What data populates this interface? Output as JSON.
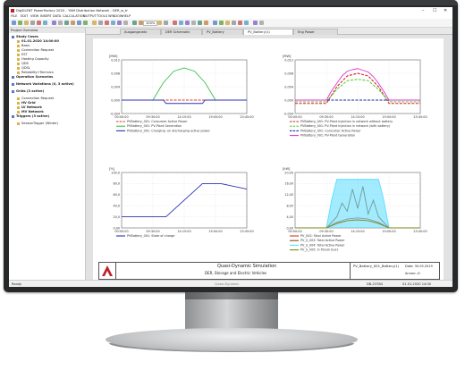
{
  "window": {
    "title": "DIgSILENT PowerFactory 2020 - 'YAM Distribution Network - DER_w_b'",
    "minimize_glyph": "–",
    "maximize_glyph": "☐",
    "close_glyph": "✕"
  },
  "menu": [
    "FILE",
    "EDIT",
    "VIEW",
    "INSERT",
    "DATA",
    "CALCULATION",
    "OUTPUT",
    "TOOLS",
    "WINDOW",
    "HELP"
  ],
  "toolbar": {
    "zoom": "100%"
  },
  "tabs": [
    "Ausgangsnetz",
    "DER Schematic",
    "PV_Battery",
    "PV_Battery(1)",
    "Eng Power"
  ],
  "sidebar": {
    "header": "Project Overview",
    "sections": [
      {
        "label": "Study Cases",
        "bold": true,
        "indent": 0
      },
      {
        "label": "01.01.2020 14:00:00",
        "bold": true,
        "indent": 1
      },
      {
        "label": "Basic",
        "bold": false,
        "indent": 1
      },
      {
        "label": "Connection Request",
        "bold": false,
        "indent": 1
      },
      {
        "label": "EST",
        "bold": false,
        "indent": 1
      },
      {
        "label": "Hosting Capacity",
        "bold": false,
        "indent": 1
      },
      {
        "label": "QDS",
        "bold": false,
        "indent": 1
      },
      {
        "label": "QDSL",
        "bold": false,
        "indent": 1
      },
      {
        "label": "Reliability+Technics",
        "bold": false,
        "indent": 1
      },
      {
        "label": "Operation Scenarios",
        "bold": true,
        "indent": 0
      },
      {
        "label": "Network Variations (0, 3 active)",
        "bold": true,
        "indent": 0
      },
      {
        "label": "Grids (3 active)",
        "bold": true,
        "indent": 0
      },
      {
        "label": "Connection Request",
        "bold": false,
        "indent": 1
      },
      {
        "label": "HV Grid",
        "bold": true,
        "indent": 1
      },
      {
        "label": "LV Network",
        "bold": true,
        "indent": 1
      },
      {
        "label": "MV Network",
        "bold": true,
        "indent": 1
      },
      {
        "label": "Triggers (3 active)",
        "bold": true,
        "indent": 0
      },
      {
        "label": "SeasonTrigger (Winter)",
        "bold": false,
        "indent": 1
      }
    ]
  },
  "footer": {
    "title": "Quasi-Dynamic Simulation",
    "subtitle": "DER, Storage and Electric Vehicles",
    "plot_name": "PV_Battery_001_Battery(1)",
    "date": "Date: 30.05.2019",
    "annex": "Annex: /4"
  },
  "status": {
    "left": "Ready",
    "center": "Quasi-Dynamic",
    "right1": "DB-23784",
    "right2": "01.01.2020 14:00"
  },
  "colors": {
    "green": "#3ec04a",
    "blue": "#2a34b0",
    "red": "#e0342c",
    "dash_red": "#d82020",
    "dash_green": "#5ecf3c",
    "dash_blue": "#1b2a9a",
    "magenta": "#e030d0",
    "brown": "#8a4a14",
    "cyan": "#58dcff",
    "olive": "#7a8a10"
  },
  "chart_data": [
    {
      "type": "line",
      "ylabel": "[MW]",
      "ylim": [
        -0.004,
        0.012
      ],
      "yticks": [
        "0,012",
        "0,008",
        "0,004",
        "0,000",
        "-0,004"
      ],
      "xticks": [
        "00:00:00",
        "09:30:00",
        "14:15:00",
        "19:00:00",
        "23:45:00"
      ],
      "series": [
        {
          "name": "PVBattery_001: Consumer Active Power",
          "style": "dashed",
          "color_key": "red",
          "x": [
            0,
            4,
            8,
            12,
            16,
            20,
            24
          ],
          "y": [
            0.0,
            0.0,
            0.0,
            0.0,
            0.0,
            0.0,
            0.0
          ]
        },
        {
          "name": "PVBattery_001: PV-Plant Generation",
          "style": "solid",
          "color_key": "green",
          "x": [
            0,
            6,
            8,
            10,
            12,
            14,
            16,
            18,
            24
          ],
          "y": [
            0.0,
            0.0,
            0.0052,
            0.0086,
            0.0096,
            0.0086,
            0.0052,
            0.0,
            0.0
          ]
        },
        {
          "name": "PVBattery_001: Charging- on discharging active power",
          "style": "solid",
          "color_key": "blue",
          "x": [
            0,
            8,
            8.5,
            15.5,
            16,
            24
          ],
          "y": [
            0.0,
            0.0,
            -0.001,
            -0.001,
            0.0,
            0.0
          ]
        }
      ]
    },
    {
      "type": "line",
      "ylabel": "[MW]",
      "ylim": [
        -0.004,
        0.012
      ],
      "yticks": [
        "0,012",
        "0,008",
        "0,004",
        "0,000",
        "-0,004"
      ],
      "xticks": [
        "00:00:00",
        "09:30:00",
        "14:15:00",
        "19:00:00",
        "23:45:00"
      ],
      "series": [
        {
          "name": "PVBattery_001: PV-Plant Injection in network without battery",
          "style": "dashed",
          "color_key": "dash_red",
          "x": [
            0,
            6,
            8,
            10,
            12,
            14,
            16,
            18,
            24
          ],
          "y": [
            -0.001,
            -0.001,
            0.004,
            0.0072,
            0.008,
            0.0072,
            0.004,
            -0.001,
            -0.001
          ]
        },
        {
          "name": "PVBattery_001: PV-Plant Injection in network (with battery)",
          "style": "dashed",
          "color_key": "dash_green",
          "x": [
            0,
            6,
            8,
            10,
            12,
            14,
            16,
            18,
            24
          ],
          "y": [
            -0.0005,
            -0.0005,
            0.0032,
            0.0058,
            0.0062,
            0.0058,
            0.0032,
            -0.0005,
            -0.0005
          ]
        },
        {
          "name": "PVBattery_001: Consumer Active Power",
          "style": "dashed",
          "color_key": "dash_blue",
          "x": [
            0,
            4,
            8,
            12,
            16,
            20,
            24
          ],
          "y": [
            0.0,
            0.0,
            0.0,
            0.0,
            0.0,
            0.0,
            0.0
          ]
        },
        {
          "name": "PVBattery_001: PV-Plant Generation",
          "style": "solid",
          "color_key": "magenta",
          "x": [
            0,
            6,
            7,
            8,
            9,
            10,
            11,
            12,
            13,
            14,
            15,
            16,
            17,
            18,
            24
          ],
          "y": [
            0.0,
            0.0,
            0.0028,
            0.005,
            0.0072,
            0.0086,
            0.0091,
            0.0094,
            0.0089,
            0.0084,
            0.007,
            0.005,
            0.0026,
            0.0,
            0.0
          ]
        }
      ]
    },
    {
      "type": "line",
      "ylabel": "[%]",
      "ylim": [
        0,
        100
      ],
      "yticks": [
        "100,0",
        "80,0",
        "60,0",
        "40,0",
        "20,0",
        "0,00"
      ],
      "xticks": [
        "00:00:00",
        "09:30:00",
        "14:15:00",
        "19:00:00",
        "23:45:00"
      ],
      "series": [
        {
          "name": "PVBattery_001: State of charge",
          "style": "solid",
          "color_key": "blue",
          "x": [
            0,
            8.5,
            15.5,
            19,
            24
          ],
          "y": [
            20,
            20,
            80,
            80,
            70
          ]
        }
      ]
    },
    {
      "type": "area",
      "ylabel": "[kW]",
      "ylim": [
        0,
        20
      ],
      "yticks": [
        "20,00",
        "16,00",
        "12,00",
        "8,00",
        "4,00",
        "0,00"
      ],
      "xticks": [
        "00:00:00",
        "09:30:00",
        "14:15:00",
        "19:00:00",
        "23:45:00"
      ],
      "series": [
        {
          "name": "PV_002: Total Active Power",
          "style": "solid",
          "color_key": "red",
          "x": [
            0,
            6,
            8,
            10,
            12,
            14,
            16,
            18,
            24
          ],
          "y": [
            0,
            0,
            2.0,
            3.2,
            3.6,
            3.2,
            2.0,
            0,
            0
          ]
        },
        {
          "name": "PV_S_003: Total Active Power",
          "style": "solid",
          "color_key": "brown",
          "x": [
            0,
            6,
            8,
            9,
            10,
            11,
            12,
            13,
            14,
            15,
            16,
            18,
            24
          ],
          "y": [
            0,
            0,
            4,
            9,
            6,
            14,
            7,
            15,
            5,
            10,
            4,
            0,
            0
          ]
        },
        {
          "name": "PV_S_004: Total Active Power",
          "style": "solid",
          "color_key": "cyan",
          "x": [
            0,
            6,
            7,
            8,
            16,
            17,
            18,
            24
          ],
          "y": [
            0,
            0,
            10,
            17.5,
            17.5,
            10,
            0,
            0
          ]
        },
        {
          "name": "PV_S_005: in P/sum bus1",
          "style": "solid",
          "color_key": "olive",
          "x": [
            0,
            6,
            8,
            10,
            12,
            14,
            16,
            18,
            24
          ],
          "y": [
            0,
            0,
            1.6,
            2.6,
            2.9,
            2.6,
            1.6,
            0,
            0
          ]
        }
      ]
    }
  ]
}
